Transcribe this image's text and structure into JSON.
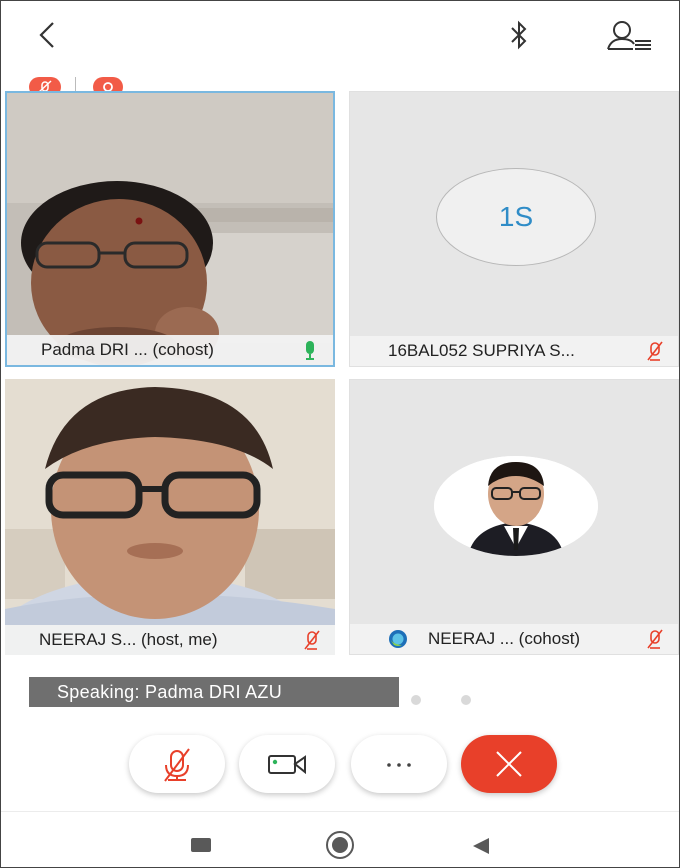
{
  "icons": {
    "back": "chevron-left-icon",
    "bluetooth": "bluetooth-icon",
    "participants": "participants-icon",
    "mic_off": "mic-off-icon",
    "mic_on": "mic-on-icon",
    "video": "video-camera-icon",
    "more": "more-horizontal-icon",
    "end": "close-icon"
  },
  "tiles": [
    {
      "name": "Padma DRI ... (cohost)",
      "mic": "on"
    },
    {
      "name": "16BAL052 SUPRIYA S...",
      "mic": "off",
      "avatar_initials": "1S"
    },
    {
      "name": "NEERAJ S... (host, me)",
      "mic": "off"
    },
    {
      "name": "NEERAJ ... (cohost)",
      "mic": "off"
    }
  ],
  "speaking": "Speaking: Padma DRI AZU",
  "controls": {
    "more_label": "···"
  },
  "colors": {
    "accent_red": "#e8402a",
    "badge_red": "#f25b47",
    "mic_green": "#2db35a",
    "initials_blue": "#2f8cc7",
    "active_border": "#7ab8e0"
  }
}
